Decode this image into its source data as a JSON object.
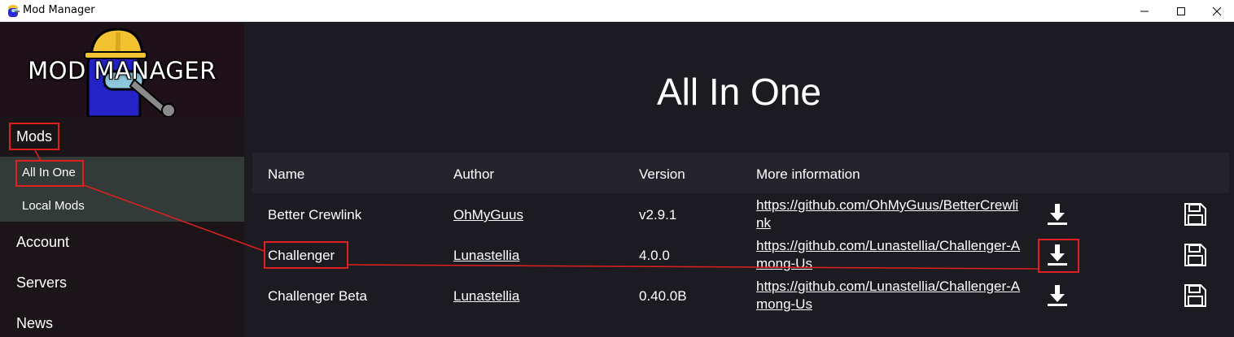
{
  "window": {
    "title": "Mod Manager",
    "icon": "among-us-crewmate-icon",
    "controls": [
      "minimize-icon",
      "maximize-icon",
      "close-icon"
    ]
  },
  "sidebar": {
    "logo_text": "MOD MANAGER",
    "items": [
      {
        "label": "Mods"
      },
      {
        "label": "Account"
      },
      {
        "label": "Servers"
      },
      {
        "label": "News"
      }
    ],
    "sub_items": [
      {
        "label": "All In One"
      },
      {
        "label": "Local Mods"
      }
    ]
  },
  "main": {
    "title": "All In One",
    "columns": [
      "Name",
      "Author",
      "Version",
      "More information"
    ],
    "rows": [
      {
        "name": "Better Crewlink",
        "author": "OhMyGuus",
        "version": "v2.9.1",
        "url": "https://github.com/OhMyGuus/BetterCrewlink"
      },
      {
        "name": "Challenger",
        "author": "Lunastellia",
        "version": "4.0.0",
        "url": "https://github.com/Lunastellia/Challenger-Among-Us"
      },
      {
        "name": "Challenger Beta",
        "author": "Lunastellia",
        "version": "0.40.0B",
        "url": "https://github.com/Lunastellia/Challenger-Among-Us"
      }
    ],
    "row_actions": [
      "download-icon",
      "save-icon"
    ]
  },
  "colors": {
    "sidebar_bg": "#1b1418",
    "sub_panel_bg": "#333b38",
    "main_bg": "#1c1b22",
    "header_bg": "#25242c",
    "annotation": "#e02020"
  }
}
